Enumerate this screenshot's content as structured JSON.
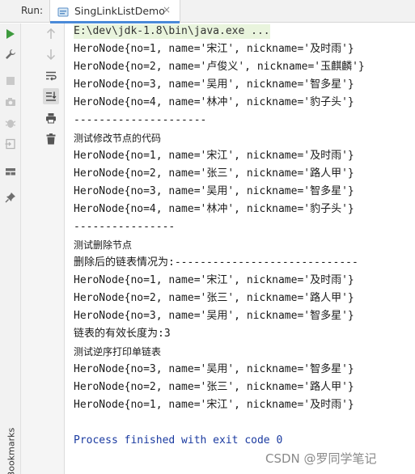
{
  "run_label": "Run:",
  "tab": {
    "title": "SingLinkListDemo",
    "close": "×"
  },
  "sidebar": {
    "bookmarks_label": "Bookmarks"
  },
  "console": {
    "command": "E:\\dev\\jdk-1.8\\bin\\java.exe ...",
    "lines": [
      "HeroNode{no=1, name='宋江', nickname='及时雨'}",
      "HeroNode{no=2, name='卢俊义', nickname='玉麒麟'}",
      "HeroNode{no=3, name='吴用', nickname='智多星'}",
      "HeroNode{no=4, name='林冲', nickname='豹子头'}",
      "---------------------",
      "测试修改节点的代码",
      "HeroNode{no=1, name='宋江', nickname='及时雨'}",
      "HeroNode{no=2, name='张三', nickname='路人甲'}",
      "HeroNode{no=3, name='吴用', nickname='智多星'}",
      "HeroNode{no=4, name='林冲', nickname='豹子头'}",
      "----------------",
      "测试删除节点",
      "删除后的链表情况为:-----------------------------",
      "HeroNode{no=1, name='宋江', nickname='及时雨'}",
      "HeroNode{no=2, name='张三', nickname='路人甲'}",
      "HeroNode{no=3, name='吴用', nickname='智多星'}",
      "链表的有效长度为:3",
      "测试逆序打印单链表",
      "HeroNode{no=3, name='吴用', nickname='智多星'}",
      "HeroNode{no=2, name='张三', nickname='路人甲'}",
      "HeroNode{no=1, name='宋江', nickname='及时雨'}"
    ],
    "exit_message": "Process finished with exit code 0"
  },
  "watermark": "CSDN @罗同学笔记",
  "colors": {
    "run_green": "#3d9a3d",
    "exit_blue": "#1a3aa0",
    "command_bg": "#e9f4dd",
    "tab_accent": "#4a8ad8"
  },
  "icons": [
    "run-icon",
    "wrench-icon",
    "stop-icon",
    "camera-icon",
    "debug-icon",
    "exit-icon",
    "layout-icon",
    "pin-icon",
    "up-arrow-icon",
    "down-arrow-icon",
    "soft-wrap-icon",
    "scroll-to-end-icon",
    "print-icon",
    "trash-icon",
    "bookmark-icon"
  ]
}
